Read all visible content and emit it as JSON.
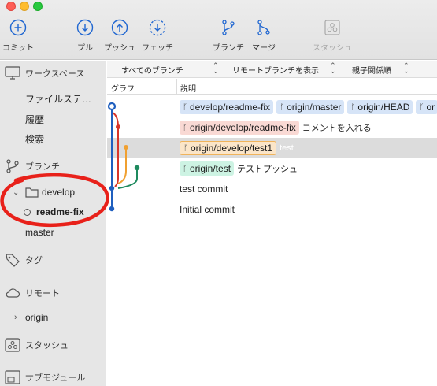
{
  "toolbar": {
    "commit": "コミット",
    "pull": "プル",
    "push": "プッシュ",
    "fetch": "フェッチ",
    "branch": "ブランチ",
    "merge": "マージ",
    "stash": "スタッシュ"
  },
  "sidebar": {
    "workspace": "ワークスペース",
    "file_status": "ファイルステ…",
    "history": "履歴",
    "search": "検索",
    "branches": "ブランチ",
    "folder_develop": "develop",
    "branch_readme_fix": "readme-fix",
    "branch_master": "master",
    "tags": "タグ",
    "remotes": "リモート",
    "remote_origin": "origin",
    "stashes": "スタッシュ",
    "submodules": "サブモジュール"
  },
  "filters": {
    "branches": "すべてのブランチ",
    "remote": "リモートブランチを表示",
    "order": "親子関係順"
  },
  "columns": {
    "graph": "グラフ",
    "description": "説明"
  },
  "commits": {
    "c1": {
      "tags": [
        "develop/readme-fix",
        "origin/master",
        "origin/HEAD",
        "or"
      ]
    },
    "c2": {
      "tag": "origin/develop/readme-fix",
      "message": "コメントを入れる"
    },
    "c3": {
      "tag": "origin/develop/test1",
      "message": "test"
    },
    "c4": {
      "tag": "origin/test",
      "message": "テストプッシュ"
    },
    "c5": {
      "message": "test commit"
    },
    "c6": {
      "message": "Initial commit"
    }
  },
  "colors": {
    "graph_blue": "#1f5fbf",
    "graph_red": "#d8352a",
    "graph_orange": "#f0a030",
    "graph_green": "#1e8a5e",
    "annotation": "#e8211a"
  },
  "icons": {
    "commit": "plus-circle-icon",
    "pull": "arrow-down-circle-icon",
    "push": "arrow-up-circle-icon",
    "fetch": "dashed-arrow-down-circle-icon",
    "branch": "branch-icon",
    "merge": "merge-icon",
    "stash": "stash-icon"
  }
}
